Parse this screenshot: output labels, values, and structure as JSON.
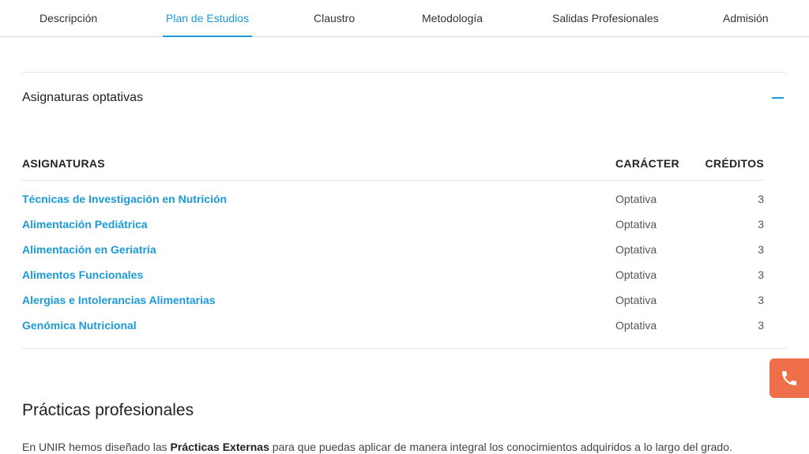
{
  "nav": {
    "tabs": [
      {
        "label": "Descripción"
      },
      {
        "label": "Plan de Estudios",
        "active": true
      },
      {
        "label": "Claustro"
      },
      {
        "label": "Metodología"
      },
      {
        "label": "Salidas Profesionales"
      },
      {
        "label": "Admisión"
      }
    ]
  },
  "accordion": {
    "title": "Asignaturas optativas",
    "toggle_icon": "minus-icon"
  },
  "table": {
    "headers": {
      "subject": "ASIGNATURAS",
      "character": "CARÁCTER",
      "credits": "CRÉDITOS"
    },
    "rows": [
      {
        "subject": "Técnicas de Investigación en Nutrición",
        "character": "Optativa",
        "credits": "3"
      },
      {
        "subject": "Alimentación Pediátrica",
        "character": "Optativa",
        "credits": "3"
      },
      {
        "subject": "Alimentación en Geriatría",
        "character": "Optativa",
        "credits": "3"
      },
      {
        "subject": "Alimentos Funcionales",
        "character": "Optativa",
        "credits": "3"
      },
      {
        "subject": "Alergias e Intolerancias Alimentarias",
        "character": "Optativa",
        "credits": "3"
      },
      {
        "subject": "Genómica Nutricional",
        "character": "Optativa",
        "credits": "3"
      }
    ]
  },
  "practicas": {
    "title": "Prácticas profesionales",
    "text_before": "En UNIR hemos diseñado las ",
    "text_bold": "Prácticas Externas",
    "text_after": " para que puedas aplicar de manera integral los conocimientos adquiridos a lo largo del grado."
  },
  "call_button": {
    "icon": "phone-icon"
  },
  "colors": {
    "accent": "#1c9ad6",
    "call": "#ef6f4a"
  }
}
